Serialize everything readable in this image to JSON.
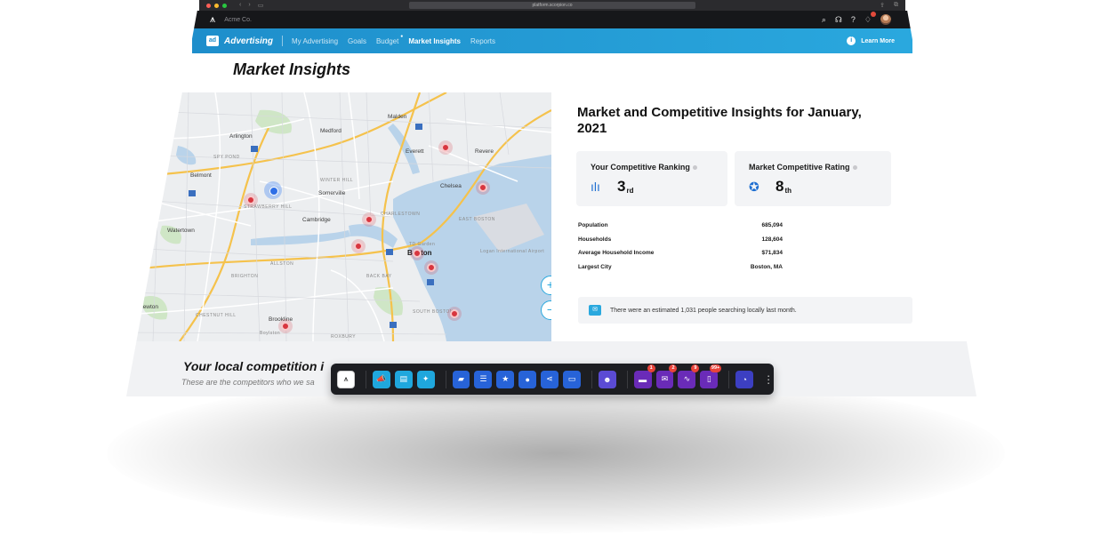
{
  "browser": {
    "url": "platform.scorpion.co"
  },
  "app": {
    "company": "Acme Co."
  },
  "nav": {
    "product": "Advertising",
    "product_icon": "ad",
    "links": [
      "My Advertising",
      "Goals",
      "Budget",
      "Market Insights",
      "Reports"
    ],
    "active": "Market Insights",
    "learn_more": "Learn More"
  },
  "page": {
    "title": "Market Insights"
  },
  "map": {
    "labels": {
      "malden": "Malden",
      "medford": "Medford",
      "arlington": "Arlington",
      "everett": "Everett",
      "revere": "Revere",
      "belmont": "Belmont",
      "somerville": "Somerville",
      "chelsea": "Chelsea",
      "cambridge": "Cambridge",
      "watertown": "Watertown",
      "east_boston": "EAST BOSTON",
      "boston": "Boston",
      "newton": "Newton",
      "brookline": "Brookline",
      "chestnut_hill": "CHESTNUT HILL",
      "roxbury": "ROXBURY",
      "south_boston": "SOUTH BOSTON",
      "back_bay": "BACK BAY",
      "allston": "ALLSTON",
      "brighton": "BRIGHTON",
      "charlestown": "CHARLESTOWN",
      "spy_pond": "SPY POND",
      "winter_hill": "WINTER HILL",
      "airport": "Logan International Airport",
      "td_garden": "TD Garden",
      "strawberry_hill": "STRAWBERRY HILL",
      "boylston": "Boylston"
    },
    "zoom_in": "+",
    "zoom_out": "−"
  },
  "insights": {
    "heading": "Market and Competitive Insights for January, 2021",
    "ranking": {
      "title": "Your Competitive Ranking",
      "value": "3",
      "suffix": "rd"
    },
    "rating": {
      "title": "Market Competitive Rating",
      "value": "8",
      "suffix": "th"
    },
    "stats": [
      {
        "label": "Population",
        "value": "685,094"
      },
      {
        "label": "Households",
        "value": "128,604"
      },
      {
        "label": "Average Household Income",
        "value": "$71,834"
      },
      {
        "label": "Largest City",
        "value": "Boston, MA"
      }
    ],
    "notice": "There were an estimated 1,031 people searching locally last month."
  },
  "competition": {
    "heading": "Your local competition i",
    "subtext": "These are the competitors who we sa"
  },
  "dock": {
    "badges": {
      "inbox": "1",
      "mail": "2",
      "analytics": "9",
      "docs": "99+"
    }
  }
}
